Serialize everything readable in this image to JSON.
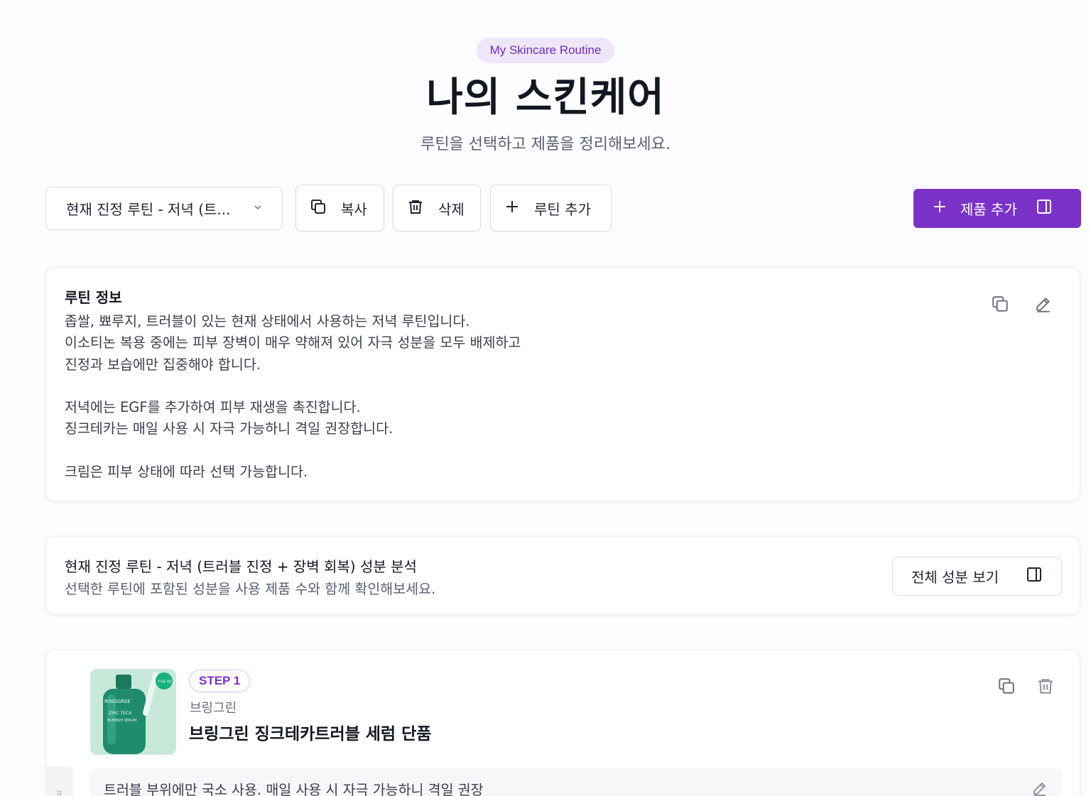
{
  "header": {
    "pill": "My Skincare Routine",
    "title": "나의 스킨케어",
    "subtitle": "루틴을 선택하고 제품을 정리해보세요."
  },
  "toolbar": {
    "routine_select_value": "현재 진정 루틴 - 저녁 (트...",
    "copy_label": "복사",
    "delete_label": "삭제",
    "add_routine_label": "루틴 추가",
    "add_product_label": "제품 추가"
  },
  "routine_info": {
    "title": "루틴 정보",
    "body": "좁쌀, 뾰루지, 트러블이 있는 현재 상태에서 사용하는 저녁 루틴입니다.\n이소티논 복용 중에는 피부 장벽이 매우 약해져 있어 자극 성분을 모두 배제하고\n진정과 보습에만 집중해야 합니다.\n\n저녁에는 EGF를 추가하여 피부 재생을 촉진합니다.\n징크테카는 매일 사용 시 자극 가능하니 격일 권장합니다.\n\n크림은 피부 상태에 따라 선택 가능합니다."
  },
  "analysis": {
    "title": "현재 진정 루틴 - 저녁 (트러블 진정 + 장벽 회복) 성분 분석",
    "subtitle": "선택한 루틴에 포함된 성분을 사용 제품 수와 함께 확인해보세요.",
    "button_label": "전체 성분 보기"
  },
  "steps": [
    {
      "badge": "STEP 1",
      "brand": "브링그린",
      "name": "브링그린 징크테카트러블 세럼 단품",
      "note": "트러블 부위에만 국소 사용. 매일 사용 시 자극 가능하니 격일 권장",
      "image_label": "RINGGREE",
      "image_sub": "ZINC TECA",
      "image_sub2": "BLEMISH SERUM",
      "sticker": "트러블 세럼"
    }
  ],
  "colors": {
    "accent": "#7a32c8",
    "pill_bg": "#efe6fb",
    "pill_text": "#6b2fb8"
  }
}
